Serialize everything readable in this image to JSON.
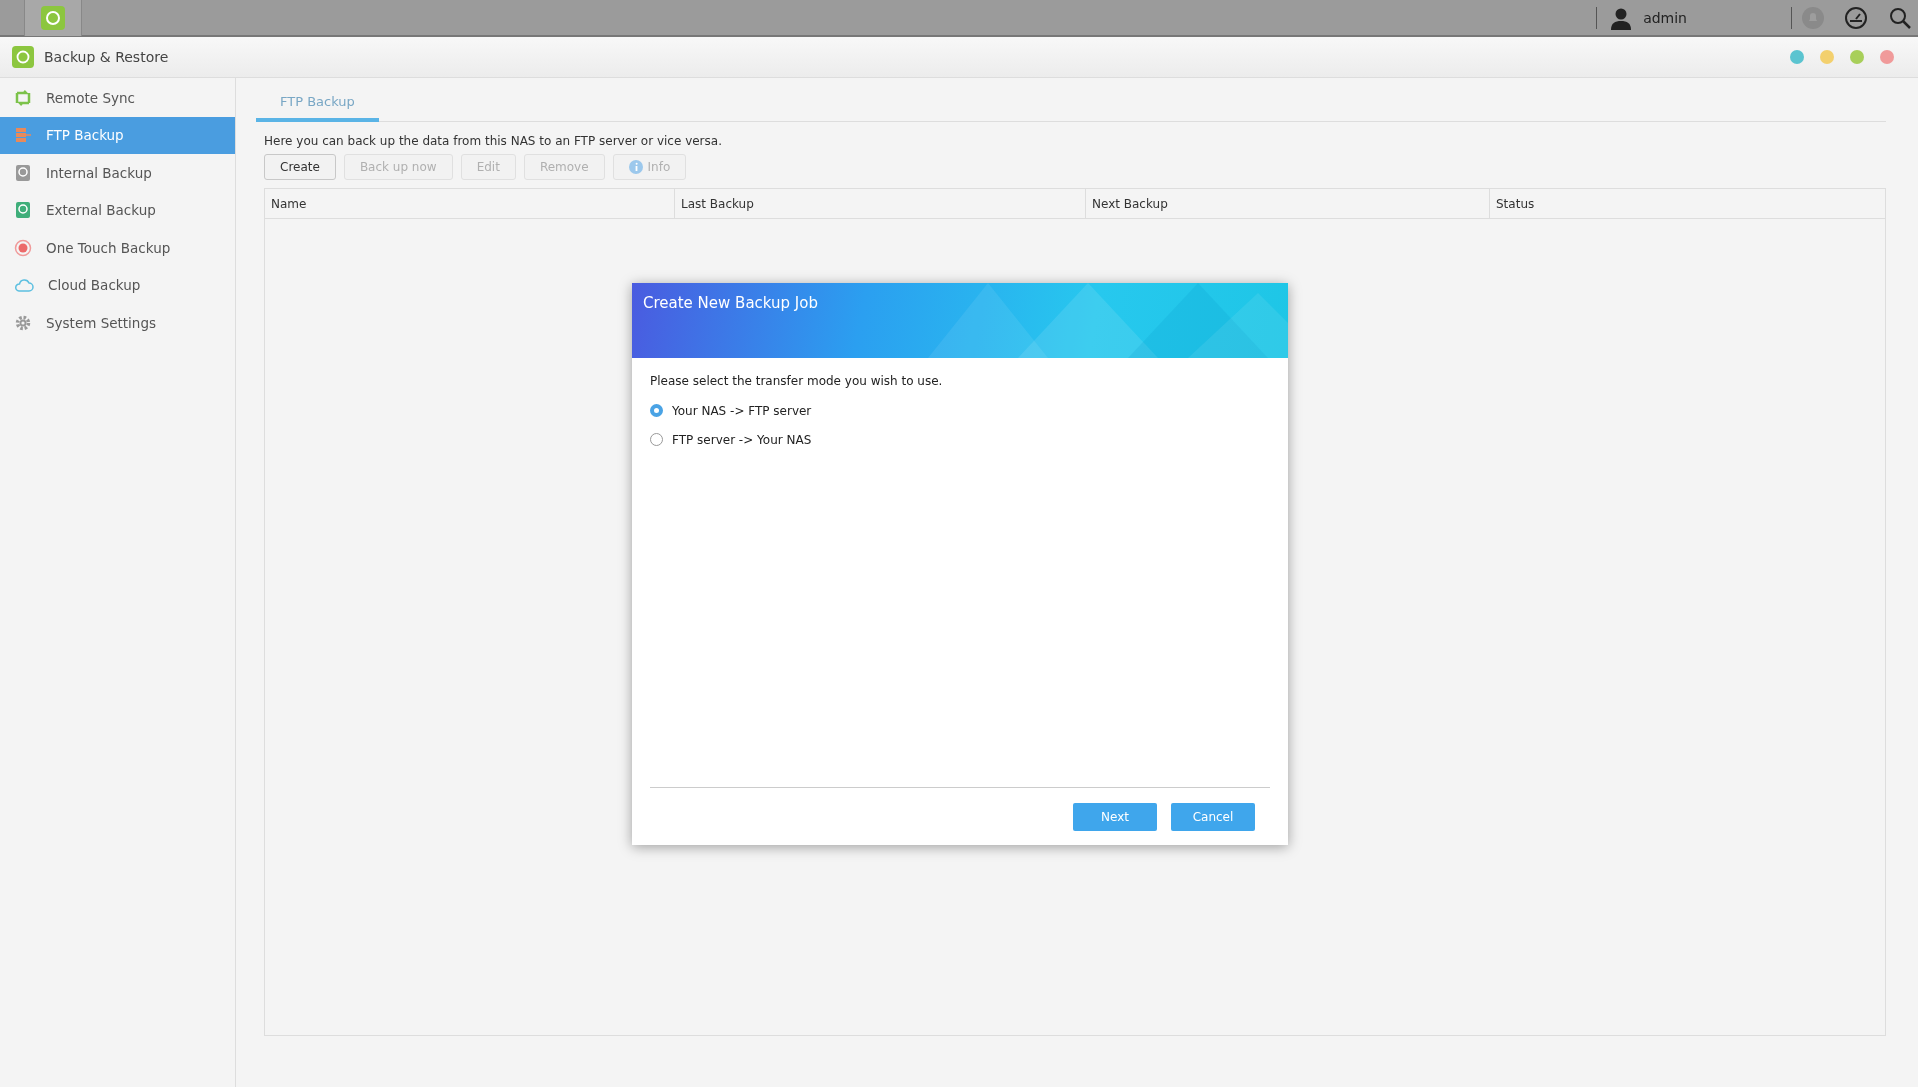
{
  "top_bar": {
    "user": "admin"
  },
  "app": {
    "title": "Backup & Restore",
    "window_controls": [
      {
        "color": "#5bc4d0"
      },
      {
        "color": "#f3d06e"
      },
      {
        "color": "#a8cf5a"
      },
      {
        "color": "#f09a9a"
      }
    ]
  },
  "sidebar": {
    "items": [
      {
        "label": "Remote Sync",
        "kind": "sync",
        "selected": false
      },
      {
        "label": "FTP Backup",
        "kind": "ftp",
        "selected": true
      },
      {
        "label": "Internal Backup",
        "kind": "internal",
        "selected": false
      },
      {
        "label": "External Backup",
        "kind": "external",
        "selected": false
      },
      {
        "label": "One Touch Backup",
        "kind": "onetouch",
        "selected": false
      },
      {
        "label": "Cloud Backup",
        "kind": "cloud",
        "selected": false
      },
      {
        "label": "System Settings",
        "kind": "settings",
        "selected": false
      }
    ]
  },
  "tabs": [
    {
      "label": "FTP Backup",
      "selected": true
    }
  ],
  "description": "Here you can back up the data from this NAS to an FTP server or vice versa.",
  "toolbar": [
    {
      "label": "Create",
      "disabled": false,
      "kind": "plain"
    },
    {
      "label": "Back up now",
      "disabled": true,
      "kind": "plain"
    },
    {
      "label": "Edit",
      "disabled": true,
      "kind": "plain"
    },
    {
      "label": "Remove",
      "disabled": true,
      "kind": "plain"
    },
    {
      "label": "Info",
      "disabled": true,
      "kind": "info"
    }
  ],
  "table": {
    "columns": [
      "Name",
      "Last Backup",
      "Next Backup",
      "Status"
    ]
  },
  "dialog": {
    "title": "Create New Backup Job",
    "prompt": "Please select the transfer mode you wish to use.",
    "options": [
      {
        "label": "Your NAS -> FTP server",
        "selected": true
      },
      {
        "label": "FTP server -> Your NAS",
        "selected": false
      }
    ],
    "buttons": [
      "Next",
      "Cancel"
    ]
  }
}
